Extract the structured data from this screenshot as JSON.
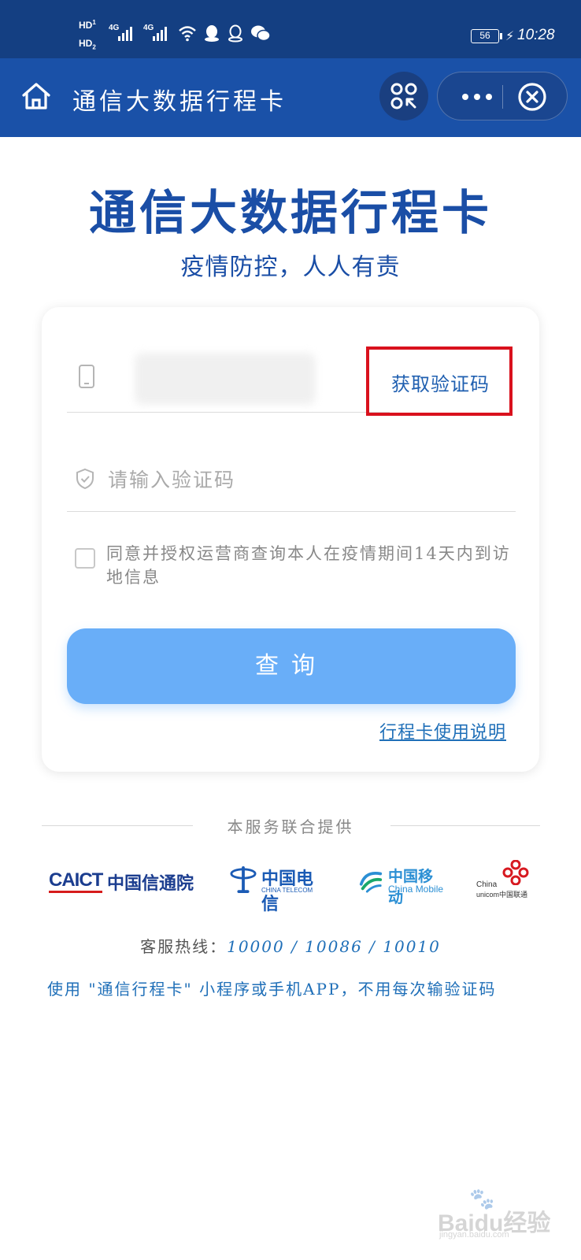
{
  "status_bar": {
    "hd1": "HD",
    "hd1_sub": "1",
    "hd2": "HD",
    "hd2_sub": "2",
    "net1": "4G",
    "net2": "4G",
    "battery": "56",
    "time": "10:28"
  },
  "nav": {
    "title": "通信大数据行程卡",
    "icons": [
      "home-icon",
      "scan-icon",
      "more-icon",
      "close-icon"
    ]
  },
  "header": {
    "title": "通信大数据行程卡",
    "slogan": "疫情防控，人人有责"
  },
  "form": {
    "phone_value": "",
    "get_code_label": "获取验证码",
    "code_placeholder": "请输入验证码",
    "agree_checked": false,
    "agree_text": "同意并授权运营商查询本人在疫情期间14天内到访地信息",
    "query_button": "查询",
    "guide_link": "行程卡使用说明"
  },
  "footer": {
    "provider_label": "本服务联合提供",
    "providers": {
      "caict_en": "CAICT",
      "caict_cn": "中国信通院",
      "telecom_cn": "中国电信",
      "telecom_en": "CHINA TELECOM",
      "mobile_cn": "中国移动",
      "mobile_en": "China Mobile",
      "unicom_en1": "China",
      "unicom_en2": "unicom中国联通"
    },
    "hotline_label": "客服热线：",
    "hotline_numbers": "10000 / 10086 / 10010",
    "tip": "使用 \"通信行程卡\" 小程序或手机APP，不用每次输验证码"
  },
  "watermark": {
    "text": "Baidu经验",
    "url": "jingyan.baidu.com"
  },
  "colors": {
    "status_bar": "#143f82",
    "nav_bar": "#1a51a8",
    "title_blue": "#1a4ea6",
    "button_blue": "#69aef8",
    "link_blue": "#1f6fb8",
    "highlight_red": "#d9111d"
  }
}
